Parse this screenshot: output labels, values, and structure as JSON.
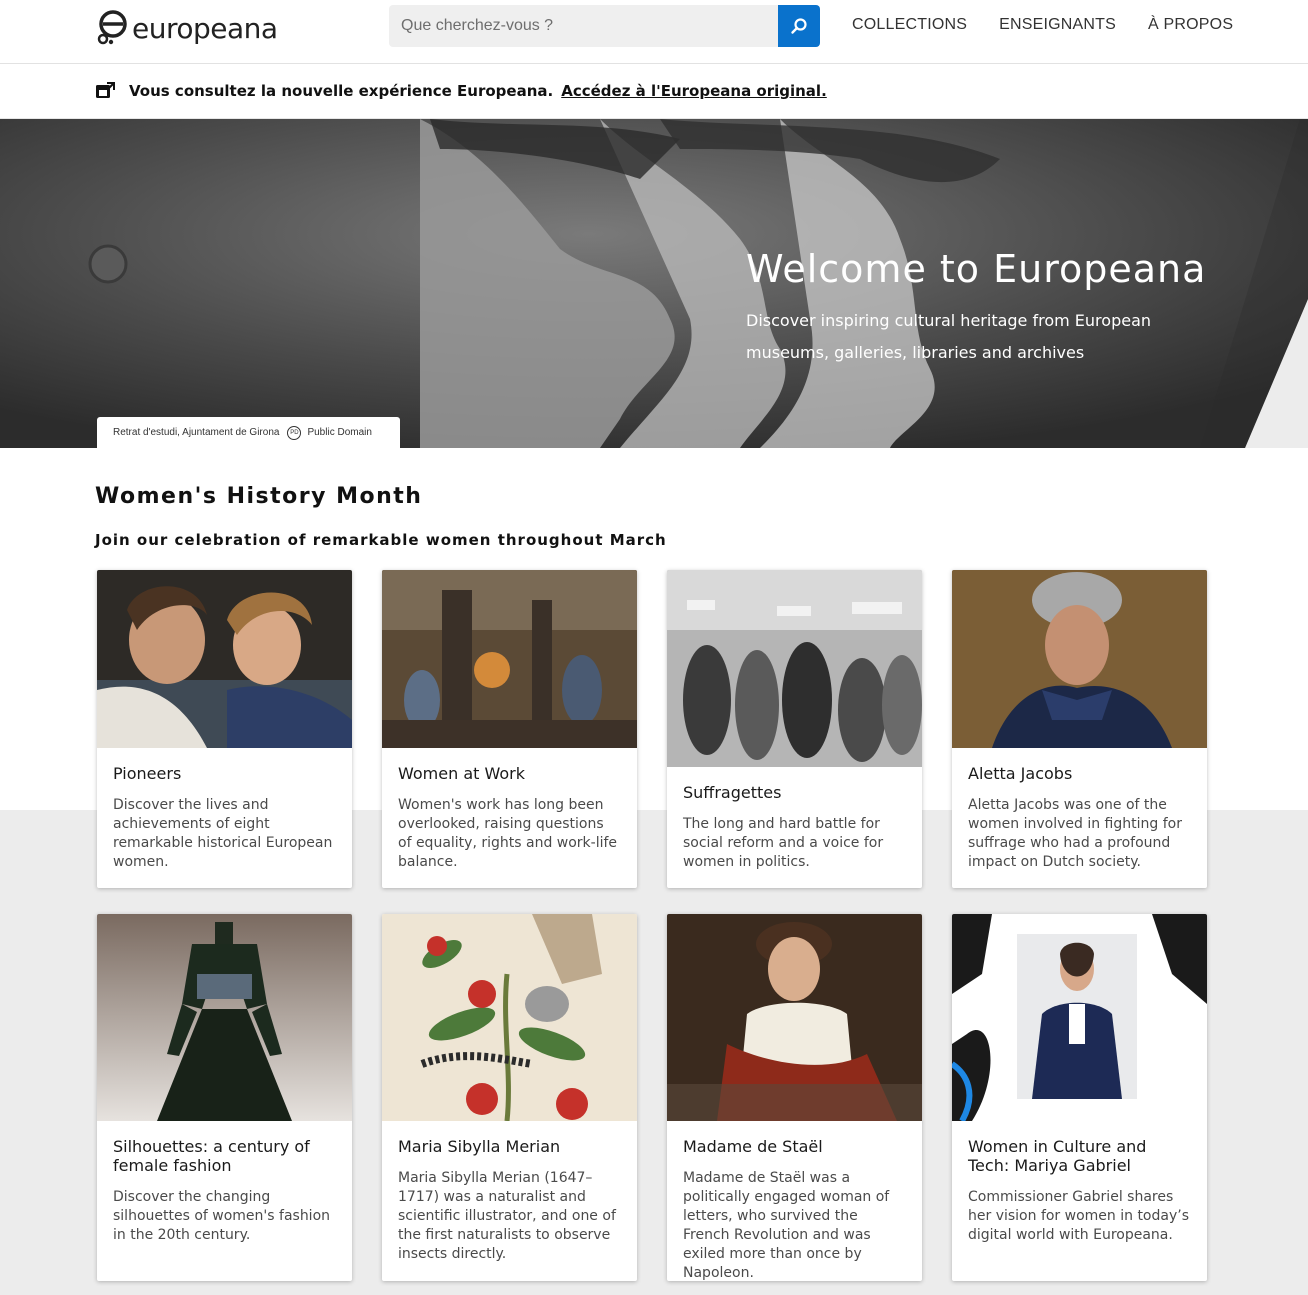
{
  "header": {
    "logo_text": "europeana",
    "search_placeholder": "Que cherchez-vous ?",
    "nav": [
      "COLLECTIONS",
      "ENSEIGNANTS",
      "À PROPOS"
    ]
  },
  "notice": {
    "text": "Vous consultez la nouvelle expérience Europeana.",
    "link": "Accédez à l'Europeana original."
  },
  "hero": {
    "title": "Welcome to Europeana",
    "subtitle": "Discover inspiring cultural heritage from European museums, galleries, libraries and archives",
    "credit": "Retrat d'estudi, Ajuntament de Girona",
    "license": "Public Domain"
  },
  "section": {
    "title": "Women's History Month",
    "subtitle": "Join our celebration of remarkable women throughout March"
  },
  "cards": [
    {
      "title": "Pioneers",
      "description": "Discover the lives and achievements of eight remarkable historical European women."
    },
    {
      "title": "Women at Work",
      "description": "Women's work has long been overlooked, raising questions of equality, rights and work-life balance."
    },
    {
      "title": "Suffragettes",
      "description": "The long and hard battle for social reform and a voice for women in politics."
    },
    {
      "title": "Aletta Jacobs",
      "description": "Aletta Jacobs was one of the women involved in fighting for suffrage who had a profound impact on Dutch society."
    },
    {
      "title": "Silhouettes: a century of female fashion",
      "description": "Discover the changing silhouettes of women's fashion in the 20th century."
    },
    {
      "title": "Maria Sibylla Merian",
      "description": "Maria Sibylla Merian (1647–1717) was a naturalist and scientific illustrator, and one of the first naturalists to observe insects directly."
    },
    {
      "title": "Madame de Staël",
      "description": "Madame de Staël was a politically engaged woman of letters, who survived the French Revolution and was exiled more than once by Napoleon."
    },
    {
      "title": "Women in Culture and Tech: Mariya Gabriel",
      "description": "Commissioner Gabriel shares her vision for women in today’s digital world with Europeana."
    }
  ],
  "colors": {
    "accent": "#0a72cc",
    "section_bg": "#ececec"
  }
}
